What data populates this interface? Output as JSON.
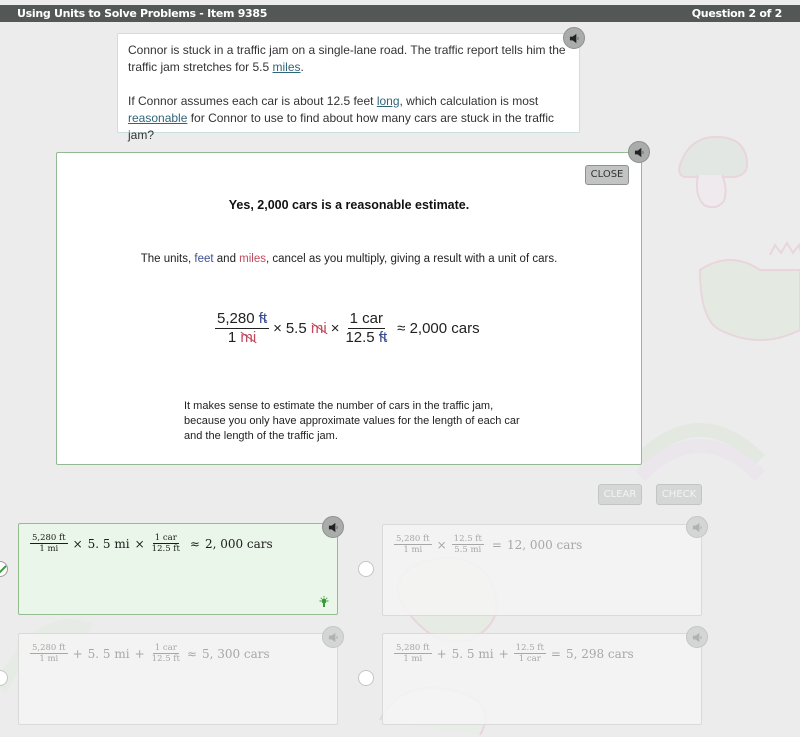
{
  "header": {
    "title": "Using Units to Solve Problems - Item 9385",
    "question_counter": "Question 2 of 2"
  },
  "stem": {
    "p1_before": "Connor is stuck in a traffic jam on a single-lane road. The traffic report tells him the traffic jam stretches for 5.5 ",
    "p1_link": "miles",
    "p1_after": ".",
    "p2_before": "If Connor assumes each car is about 12.5 feet ",
    "p2_link1": "long",
    "p2_mid": ", which calculation is most ",
    "p2_link2": "reasonable",
    "p2_after": " for Connor to use to find about how many cars are stuck in the traffic jam?",
    "audio_icon": "speaker-icon"
  },
  "feedback": {
    "close_label": "CLOSE",
    "heading": "Yes, 2,000 cars is a reasonable estimate.",
    "units_prefix": "The units, ",
    "units_feet": "feet",
    "units_and": " and ",
    "units_miles": "miles",
    "units_suffix": ", cancel as you multiply, giving a result with a unit of cars.",
    "equation": {
      "f1_num_val": "5,280 ",
      "f1_num_unit": "ft",
      "f1_den_val": "1 ",
      "f1_den_unit": "mi",
      "times1": "×",
      "mid_val": "5.5 ",
      "mid_unit": "mi",
      "times2": "×",
      "f2_num": "1 car",
      "f2_den_val": "12.5 ",
      "f2_den_unit": "ft",
      "result": "≈ 2,000 cars"
    },
    "explanation": "It makes sense to estimate the number of cars in the traffic jam, because you only have approximate values for the length of each car and the length of the traffic jam.",
    "colors": {
      "feet": "#3a4e94",
      "miles": "#c2495d"
    }
  },
  "actions": {
    "clear_label": "CLEAR",
    "check_label": "CHECK"
  },
  "options": [
    {
      "selected": true,
      "f1_num": "5,280  ft",
      "f1_den": "1  mi",
      "op1": "×",
      "mid": "5. 5 mi",
      "op2": "×",
      "f2_num": "1  car",
      "f2_den": "12.5  ft",
      "rel": "≈",
      "result": "2, 000  cars"
    },
    {
      "selected": false,
      "f1_num": "5,280  ft",
      "f1_den": "1  mi",
      "op1": "×",
      "mid": "",
      "op2": "",
      "f2_num": "12.5  ft",
      "f2_den": "5.5  mi",
      "rel": "=",
      "result": "12, 000  cars"
    },
    {
      "selected": false,
      "f1_num": "5,280  ft",
      "f1_den": "1  mi",
      "op1": "+",
      "mid": "5. 5  mi",
      "op2": "+",
      "f2_num": "1  car",
      "f2_den": "12.5  ft",
      "rel": "≈",
      "result": "5, 300  cars"
    },
    {
      "selected": false,
      "f1_num": "5,280  ft",
      "f1_den": "1  mi",
      "op1": "+",
      "mid": "5. 5  mi",
      "op2": "+",
      "f2_num": "12.5  ft",
      "f2_den": "1  car",
      "rel": "=",
      "result": "5, 298  cars"
    }
  ]
}
